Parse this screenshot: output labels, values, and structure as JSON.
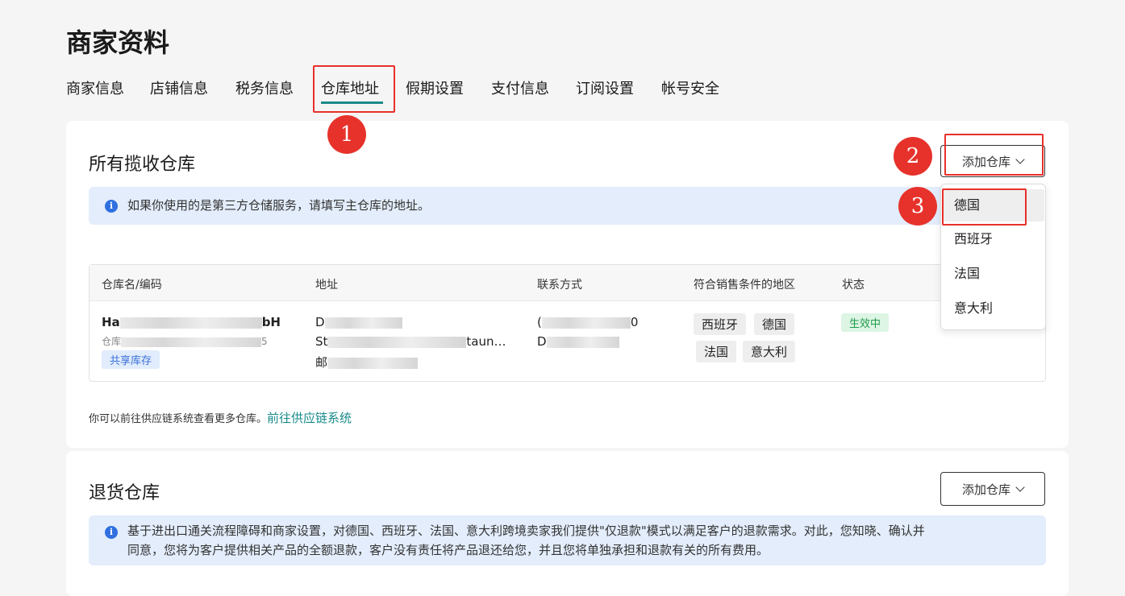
{
  "page": {
    "title": "商家资料"
  },
  "tabs": [
    {
      "label": "商家信息"
    },
    {
      "label": "店铺信息"
    },
    {
      "label": "税务信息"
    },
    {
      "label": "仓库地址",
      "active": true
    },
    {
      "label": "假期设置"
    },
    {
      "label": "支付信息"
    },
    {
      "label": "订阅设置"
    },
    {
      "label": "帐号安全"
    }
  ],
  "pickup": {
    "title": "所有揽收仓库",
    "add_button": "添加仓库",
    "info": "如果你使用的是第三方仓储服务，请填写主仓库的地址。",
    "columns": [
      "仓库名/编码",
      "地址",
      "联系方式",
      "符合销售条件的地区",
      "状态"
    ],
    "row": {
      "name_start": "Ha",
      "name_end": "bH",
      "code_start": "仓库",
      "code_end": "5",
      "tag": "共享库存",
      "addr_line1": "D",
      "addr_line2_start": "St",
      "addr_line2_end": "taun…",
      "addr_line3": "邮",
      "contact_line1_start": "(",
      "contact_line1_end": "0",
      "contact_line2": "D",
      "regions": [
        "西班牙",
        "德国",
        "法国",
        "意大利"
      ],
      "status": "生效中"
    },
    "footer_note": "你可以前往供应链系统查看更多仓库。",
    "footer_link": "前往供应链系统"
  },
  "dropdown": {
    "items": [
      "德国",
      "西班牙",
      "法国",
      "意大利"
    ],
    "highlighted": "德国"
  },
  "returns": {
    "title": "退货仓库",
    "add_button": "添加仓库",
    "info_line1": "基于进出口通关流程障碍和商家设置，对德国、西班牙、法国、意大利跨境卖家我们提供\"仅退款\"模式以满足客户的退款需求。对此，您知晓、确认并",
    "info_line2": "同意，您将为客户提供相关产品的全额退款，客户没有责任将产品退还给您，并且您将单独承担和退款有关的所有费用。"
  },
  "annotations": {
    "markers": [
      "1",
      "2",
      "3"
    ],
    "color": "#e7322c"
  },
  "colors": {
    "accent": "#1a8a8a",
    "info_bg": "#e3edfb",
    "info_icon": "#2f6fe0",
    "status_green": "#1f9a4a"
  }
}
